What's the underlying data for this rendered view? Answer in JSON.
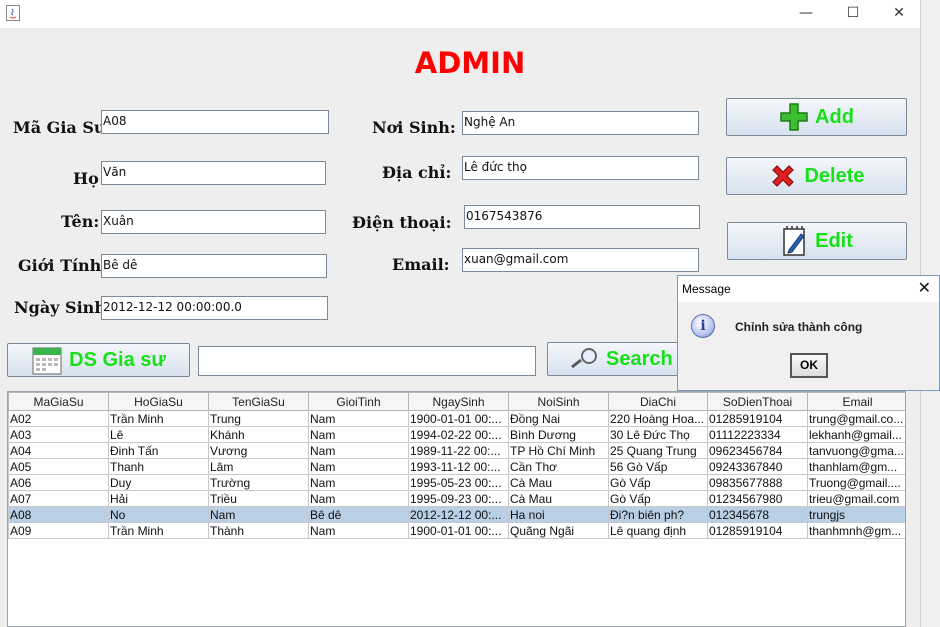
{
  "window": {
    "minimize": "—",
    "maximize": "☐",
    "close": "✕"
  },
  "title": "ADMIN",
  "form": {
    "ma_label": "Mã Gia Sư:",
    "ma_value": "A08",
    "ho_label": "Họ",
    "ho_value": "Văn",
    "ten_label": "Tên:",
    "ten_value": "Xuân",
    "gioitinh_label": "Giới Tính:",
    "gioitinh_value": "Bê dê",
    "ngaysinh_label": "Ngày Sinh:",
    "ngaysinh_value": "2012-12-12 00:00:00.0",
    "noisinh_label": "Nơi Sinh:",
    "noisinh_value": "Nghệ An",
    "diachi_label": "Địa chỉ:",
    "diachi_value": "Lê đức thọ",
    "dienthoai_label": "Điện thoại:",
    "dienthoai_value": "0167543876",
    "email_label": "Email:",
    "email_value": "xuan@gmail.com"
  },
  "buttons": {
    "add": "Add",
    "delete": "Delete",
    "edit": "Edit",
    "ds": "DS Gia sư",
    "search": "Search"
  },
  "search_value": "",
  "table": {
    "columns": [
      "MaGiaSu",
      "HoGiaSu",
      "TenGiaSu",
      "GioiTinh",
      "NgaySinh",
      "NoiSinh",
      "DiaChi",
      "SoDienThoai",
      "Email"
    ],
    "rows": [
      [
        "A02",
        "Trần Minh",
        "Trung",
        "Nam",
        "1900-01-01 00:...",
        "Đồng Nai",
        "220 Hoàng Hoa...",
        "01285919104",
        "trung@gmail.co..."
      ],
      [
        "A03",
        "Lê",
        "Khánh",
        "Nam",
        "1994-02-22 00:...",
        "Bình Dương",
        "30 Lê Đức Thọ",
        "01112223334",
        "lekhanh@gmail..."
      ],
      [
        "A04",
        "Đinh Tấn",
        "Vương",
        "Nam",
        "1989-11-22 00:...",
        "TP Hồ Chí Minh",
        "25 Quang Trung",
        "09623456784",
        "tanvuong@gma..."
      ],
      [
        "A05",
        "Thanh",
        "Lâm",
        "Nam",
        "1993-11-12 00:...",
        "Cần Thơ",
        "56 Gò Vấp",
        "09243367840",
        "thanhlam@gm..."
      ],
      [
        "A06",
        "Duy",
        "Trường",
        "Nam",
        "1995-05-23 00:...",
        "Cà Mau",
        "Gò Vấp",
        "09835677888",
        "Truong@gmail...."
      ],
      [
        "A07",
        "Hải",
        "Triều",
        "Nam",
        "1995-09-23 00:...",
        "Cà Mau",
        "Gò Vấp",
        "01234567980",
        "trieu@gmail.com"
      ],
      [
        "A08",
        "No",
        "Nam",
        "Bê dê",
        "2012-12-12 00:...",
        "Ha noi",
        "Đi?n biên ph?",
        "012345678",
        "trungjs"
      ],
      [
        "A09",
        "Trần Minh",
        "Thành",
        "Nam",
        "1900-01-01 00:...",
        "Quãng Ngãi",
        "Lê quang định",
        "01285919104",
        "thanhmnh@gm..."
      ]
    ],
    "selected_row": 6
  },
  "dialog": {
    "title": "Message",
    "message": "Chỉnh sửa thành công",
    "ok": "OK",
    "close": "✕"
  }
}
